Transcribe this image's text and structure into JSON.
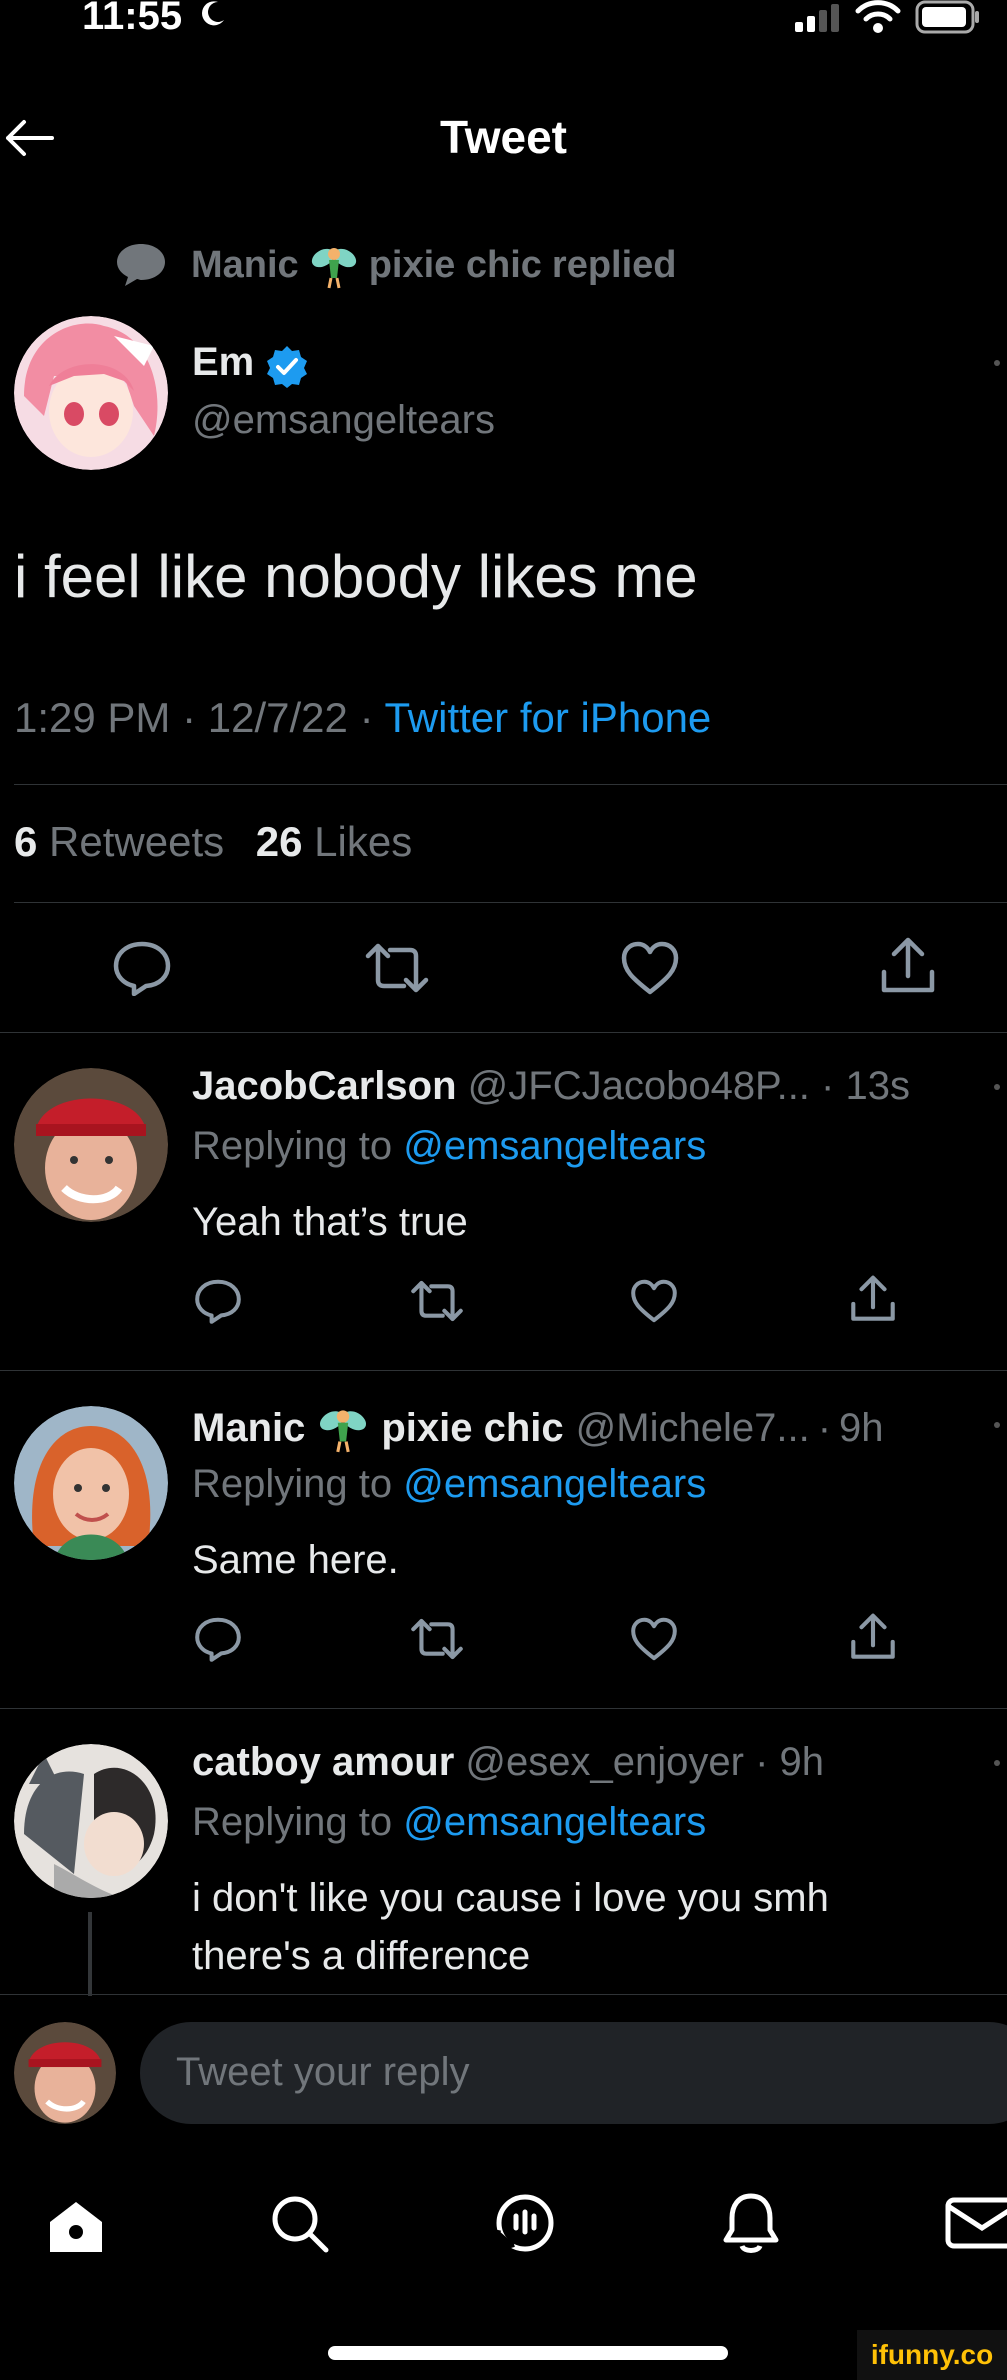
{
  "status_bar": {
    "time": "11:55"
  },
  "header": {
    "title": "Tweet"
  },
  "context": {
    "name_left": "Manic",
    "name_right": "pixie chic",
    "action": "replied"
  },
  "main_tweet": {
    "display_name": "Em",
    "handle": "@emsangeltears",
    "text": "i feel like nobody likes me",
    "time": "1:29 PM",
    "date": "12/7/22",
    "source": "Twitter for iPhone",
    "retweets_count": "6",
    "retweets_label": "Retweets",
    "likes_count": "26",
    "likes_label": "Likes"
  },
  "replies": [
    {
      "display_name": "JacobCarlson",
      "handle": "@JFCJacobo48P...",
      "age": "13s",
      "replying_label": "Replying to",
      "replying_to": "@emsangeltears",
      "text": "Yeah that’s true"
    },
    {
      "display_name_left": "Manic",
      "display_name_right": "pixie chic",
      "handle": "@Michele7...",
      "age": "9h",
      "replying_label": "Replying to",
      "replying_to": "@emsangeltears",
      "text": "Same here."
    },
    {
      "display_name": "catboy amour",
      "handle": "@esex_enjoyer",
      "age": "9h",
      "replying_label": "Replying to",
      "replying_to": "@emsangeltears",
      "text_line1": "i don't like you cause i love you smh",
      "text_line2": "there's a difference"
    }
  ],
  "composer": {
    "placeholder": "Tweet your reply"
  },
  "watermark": "ifunny.co",
  "colors": {
    "background": "#000000",
    "accent": "#1d9bf0",
    "muted": "#71767b",
    "text": "#e7e9ea"
  },
  "icons": [
    "back-arrow-icon",
    "speech-bubble-icon",
    "fairy-emoji-icon",
    "verified-badge-icon",
    "reply-icon",
    "retweet-icon",
    "like-icon",
    "share-icon",
    "home-icon",
    "search-icon",
    "spaces-icon",
    "notifications-icon",
    "messages-icon"
  ]
}
